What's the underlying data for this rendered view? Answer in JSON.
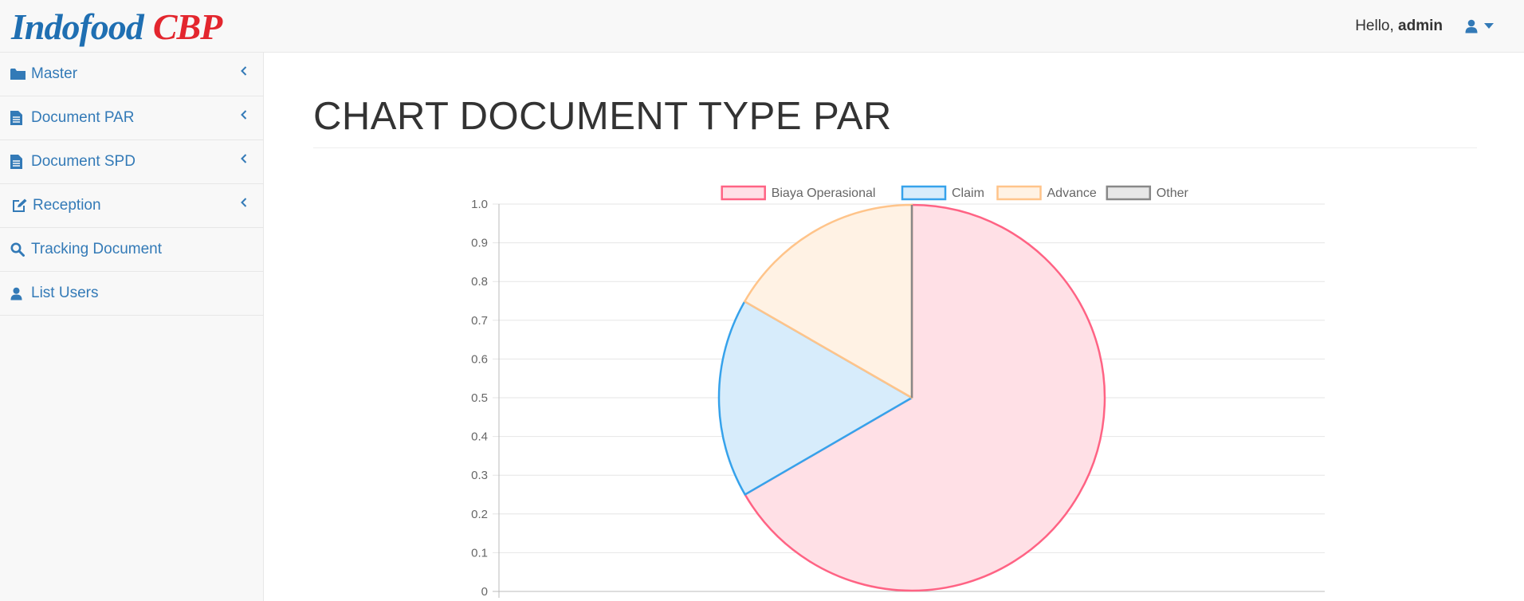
{
  "brand": {
    "part1": "Indofood",
    "part2": "CBP"
  },
  "header": {
    "greeting": "Hello,",
    "username": "admin",
    "user_icon": "user-icon",
    "caret_icon": "caret-down-icon"
  },
  "sidebar": {
    "items": [
      {
        "label": "Master",
        "icon": "folder-icon",
        "has_submenu": true
      },
      {
        "label": "Document PAR",
        "icon": "file-text-icon",
        "has_submenu": true
      },
      {
        "label": "Document SPD",
        "icon": "file-text-icon",
        "has_submenu": true
      },
      {
        "label": "Reception",
        "icon": "edit-icon",
        "has_submenu": true
      },
      {
        "label": "Tracking Document",
        "icon": "search-icon",
        "has_submenu": false
      },
      {
        "label": "List Users",
        "icon": "user-icon",
        "has_submenu": false
      }
    ]
  },
  "main": {
    "title": "CHART DOCUMENT TYPE PAR"
  },
  "colors": {
    "link": "#337ab7",
    "biaya_border": "#ff6384",
    "biaya_fill": "#ffe0e6",
    "claim_border": "#36a2eb",
    "claim_fill": "#d7ecfb",
    "advance_border": "#ffc48a",
    "advance_fill": "#fff2e4",
    "other_border": "#888888",
    "other_fill": "#e7e7e7"
  },
  "chart_data": {
    "type": "pie",
    "legend_position": "top",
    "categories": [
      "Biaya Operasional",
      "Claim",
      "Advance",
      "Other"
    ],
    "values": [
      0.667,
      0.167,
      0.167,
      0
    ],
    "y_ticks": [
      "1.0",
      "0.9",
      "0.8",
      "0.7",
      "0.6",
      "0.5",
      "0.4",
      "0.3",
      "0.2",
      "0.1",
      "0"
    ],
    "ylim": [
      0,
      1
    ],
    "grid": true
  }
}
